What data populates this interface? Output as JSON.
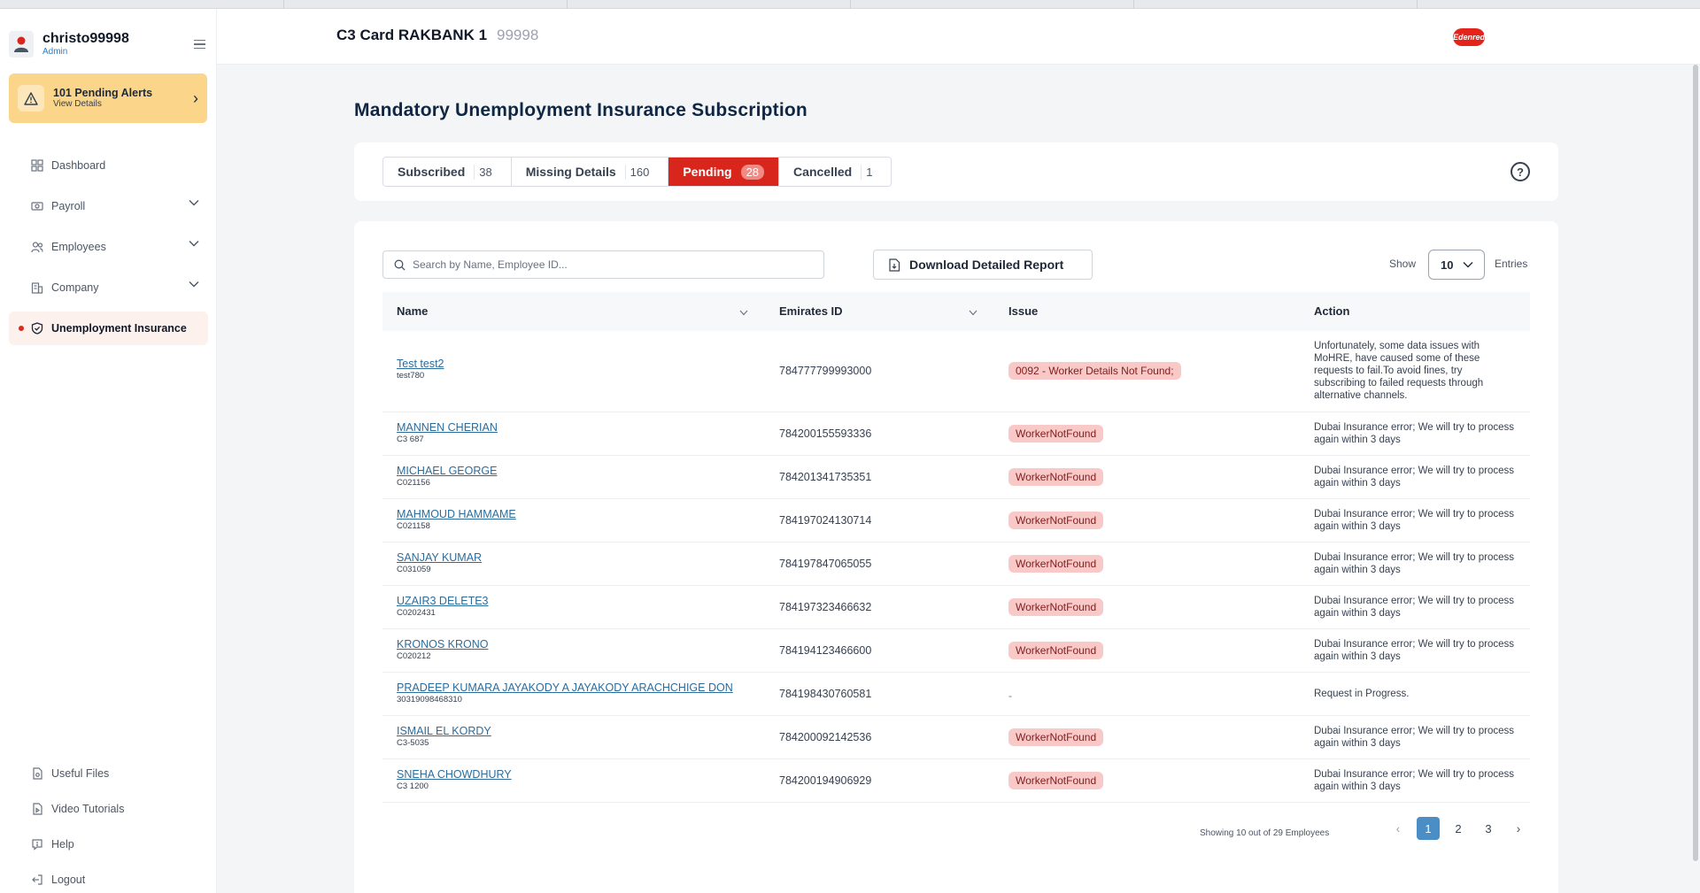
{
  "sidebar": {
    "user": {
      "name": "christo99998",
      "role": "Admin"
    },
    "alert": {
      "title": "101 Pending Alerts",
      "subtitle": "View Details"
    },
    "nav": [
      {
        "label": "Dashboard",
        "icon": "dashboard-icon"
      },
      {
        "label": "Payroll",
        "icon": "payroll-icon"
      },
      {
        "label": "Employees",
        "icon": "employees-icon"
      },
      {
        "label": "Company",
        "icon": "company-icon"
      },
      {
        "label": "Unemployment Insurance",
        "icon": "shield-check-icon"
      }
    ],
    "bottom_nav": [
      {
        "label": "Useful Files",
        "icon": "file-icon"
      },
      {
        "label": "Video Tutorials",
        "icon": "video-file-icon"
      },
      {
        "label": "Help",
        "icon": "help-chat-icon"
      },
      {
        "label": "Logout",
        "icon": "logout-icon"
      }
    ]
  },
  "header": {
    "title": "C3 Card RAKBANK 1",
    "company_id": "99998",
    "brand": "Edenred"
  },
  "page": {
    "title": "Mandatory Unemployment Insurance Subscription",
    "tabs": [
      {
        "label": "Subscribed",
        "count": "38"
      },
      {
        "label": "Missing Details",
        "count": "160"
      },
      {
        "label": "Pending",
        "count": "28"
      },
      {
        "label": "Cancelled",
        "count": "1"
      }
    ],
    "search_placeholder": "Search by Name, Employee ID...",
    "download_label": "Download Detailed Report",
    "show_label": "Show",
    "show_value": "10",
    "entries_label": "Entries"
  },
  "table": {
    "columns": [
      "Name",
      "Emirates ID",
      "Issue",
      "Action"
    ],
    "rows": [
      {
        "name": "Test test2",
        "emp_id": "test780",
        "emirates_id": "784777799993000",
        "issue": "0092 - Worker Details Not Found;",
        "action": "Unfortunately, some data issues with MoHRE, have caused some of these requests to fail.To avoid fines, try subscribing to failed requests through alternative channels."
      },
      {
        "name": "MANNEN CHERIAN",
        "emp_id": "C3 687",
        "emirates_id": "784200155593336",
        "issue": "WorkerNotFound",
        "action": "Dubai Insurance error; We will try to process again within 3 days"
      },
      {
        "name": "MICHAEL GEORGE",
        "emp_id": "C021156",
        "emirates_id": "784201341735351",
        "issue": "WorkerNotFound",
        "action": "Dubai Insurance error; We will try to process again within 3 days"
      },
      {
        "name": "MAHMOUD HAMMAME",
        "emp_id": "C021158",
        "emirates_id": "784197024130714",
        "issue": "WorkerNotFound",
        "action": "Dubai Insurance error; We will try to process again within 3 days"
      },
      {
        "name": "SANJAY KUMAR",
        "emp_id": "C031059",
        "emirates_id": "784197847065055",
        "issue": "WorkerNotFound",
        "action": "Dubai Insurance error; We will try to process again within 3 days"
      },
      {
        "name": "UZAIR3 DELETE3",
        "emp_id": "C0202431",
        "emirates_id": "784197323466632",
        "issue": "WorkerNotFound",
        "action": "Dubai Insurance error; We will try to process again within 3 days"
      },
      {
        "name": "KRONOS KRONO",
        "emp_id": "C020212",
        "emirates_id": "784194123466600",
        "issue": "WorkerNotFound",
        "action": "Dubai Insurance error; We will try to process again within 3 days"
      },
      {
        "name": "PRADEEP KUMARA JAYAKODY A JAYAKODY ARACHCHIGE DON",
        "emp_id": "30319098468310",
        "emirates_id": "784198430760581",
        "issue": "-",
        "action": "Request in Progress."
      },
      {
        "name": "ISMAIL EL KORDY",
        "emp_id": "C3-5035",
        "emirates_id": "784200092142536",
        "issue": "WorkerNotFound",
        "action": "Dubai Insurance error; We will try to process again within 3 days"
      },
      {
        "name": "SNEHA CHOWDHURY",
        "emp_id": "C3 1200",
        "emirates_id": "784200194906929",
        "issue": "WorkerNotFound",
        "action": "Dubai Insurance error; We will try to process again within 3 days"
      }
    ]
  },
  "pagination": {
    "summary": "Showing 10 out of 29 Employees",
    "pages": [
      "1",
      "2",
      "3"
    ],
    "current": "1",
    "prev": "‹",
    "next": "›"
  },
  "colors": {
    "accent_red": "#d9261c",
    "alert_yellow": "#fbd58a",
    "link_blue": "#2b6c9c",
    "pill_red": "#f9c9c7",
    "title_navy": "#0f2742"
  }
}
